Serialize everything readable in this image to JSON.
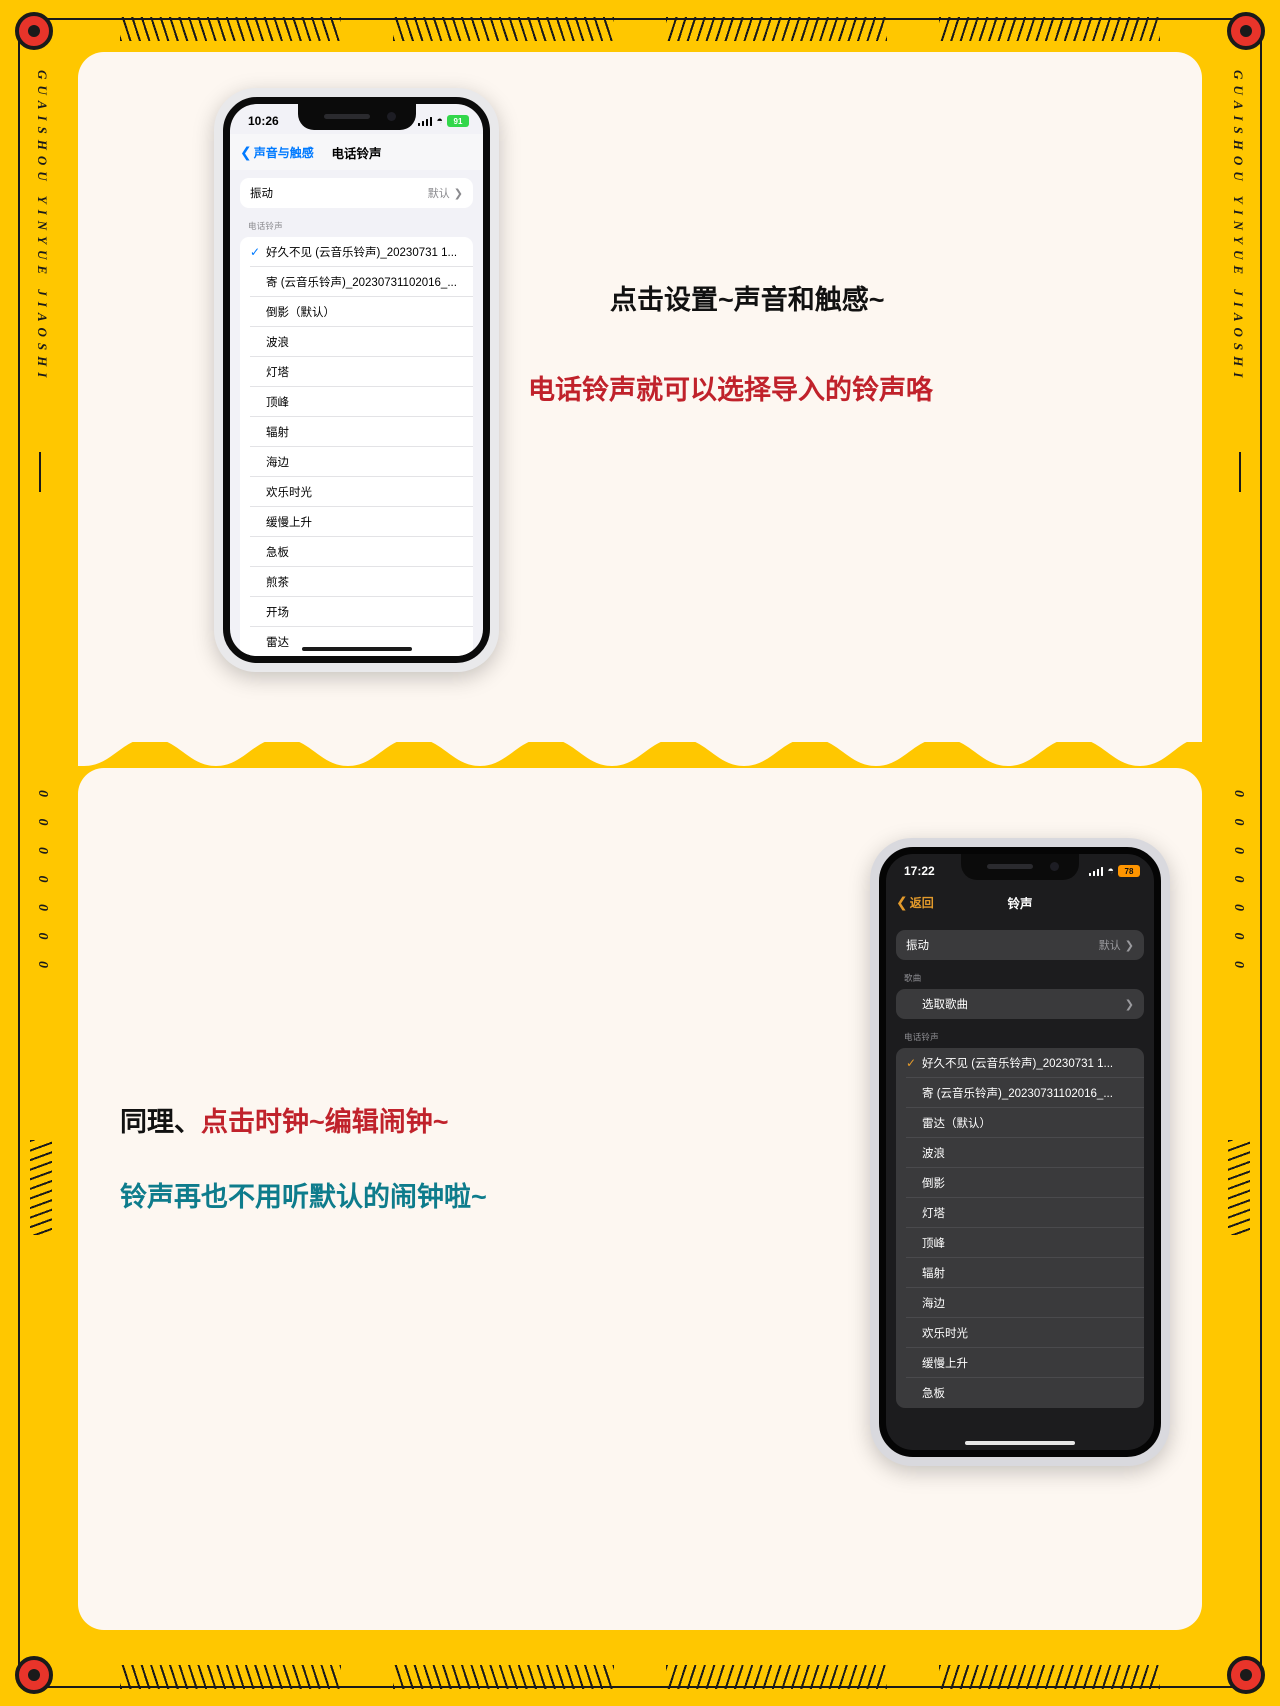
{
  "decor": {
    "side_text_upper": "GUAISHOU YINYUE JIAOSHI",
    "side_text_lower": "0 0 0 0 0 0 0",
    "bg_color": "#FFC700",
    "card_color": "#FDF7F1",
    "dot_color": "#E8342A"
  },
  "captions": {
    "line1": "点击设置~声音和触感~",
    "line2": "电话铃声就可以选择导入的铃声咯",
    "line3_plain": "同理、",
    "line3_highlight": "点击时钟~编辑闹钟~",
    "line4": "铃声再也不用听默认的闹钟啦~",
    "color_black": "#111111",
    "color_red": "#C0222B",
    "color_teal": "#0E7C8C"
  },
  "phone1": {
    "theme": "light",
    "status": {
      "time": "10:26",
      "battery": "91",
      "wifi_icon": "wifi-icon",
      "signal_icon": "cellular-bars-icon"
    },
    "nav": {
      "back_label": "声音与触感",
      "back_icon": "chevron-left-icon",
      "title": "电话铃声"
    },
    "vibration": {
      "label": "振动",
      "value": "默认",
      "chevron_icon": "chevron-right-icon"
    },
    "section_header": "电话铃声",
    "ringtones": [
      {
        "name": "好久不见 (云音乐铃声)_20230731 1...",
        "selected": true
      },
      {
        "name": "寄 (云音乐铃声)_20230731102016_...",
        "selected": false
      },
      {
        "name": "倒影（默认）",
        "selected": false
      },
      {
        "name": "波浪",
        "selected": false
      },
      {
        "name": "灯塔",
        "selected": false
      },
      {
        "name": "顶峰",
        "selected": false
      },
      {
        "name": "辐射",
        "selected": false
      },
      {
        "name": "海边",
        "selected": false
      },
      {
        "name": "欢乐时光",
        "selected": false
      },
      {
        "name": "缓慢上升",
        "selected": false
      },
      {
        "name": "急板",
        "selected": false
      },
      {
        "name": "煎茶",
        "selected": false
      },
      {
        "name": "开场",
        "selected": false
      },
      {
        "name": "雷达",
        "selected": false
      }
    ]
  },
  "phone2": {
    "theme": "dark",
    "status": {
      "time": "17:22",
      "battery": "78",
      "wifi_icon": "wifi-icon",
      "signal_icon": "cellular-bars-icon"
    },
    "nav": {
      "back_label": "返回",
      "back_icon": "chevron-left-icon",
      "title": "铃声"
    },
    "vibration": {
      "label": "振动",
      "value": "默认",
      "chevron_icon": "chevron-right-icon"
    },
    "song_header": "歌曲",
    "song_picker": {
      "label": "选取歌曲",
      "chevron_icon": "chevron-right-icon"
    },
    "section_header": "电话铃声",
    "ringtones": [
      {
        "name": "好久不见 (云音乐铃声)_20230731 1...",
        "selected": true
      },
      {
        "name": "寄 (云音乐铃声)_20230731102016_...",
        "selected": false
      },
      {
        "name": "雷达（默认）",
        "selected": false
      },
      {
        "name": "波浪",
        "selected": false
      },
      {
        "name": "倒影",
        "selected": false
      },
      {
        "name": "灯塔",
        "selected": false
      },
      {
        "name": "顶峰",
        "selected": false
      },
      {
        "name": "辐射",
        "selected": false
      },
      {
        "name": "海边",
        "selected": false
      },
      {
        "name": "欢乐时光",
        "selected": false
      },
      {
        "name": "缓慢上升",
        "selected": false
      },
      {
        "name": "急板",
        "selected": false
      }
    ]
  }
}
